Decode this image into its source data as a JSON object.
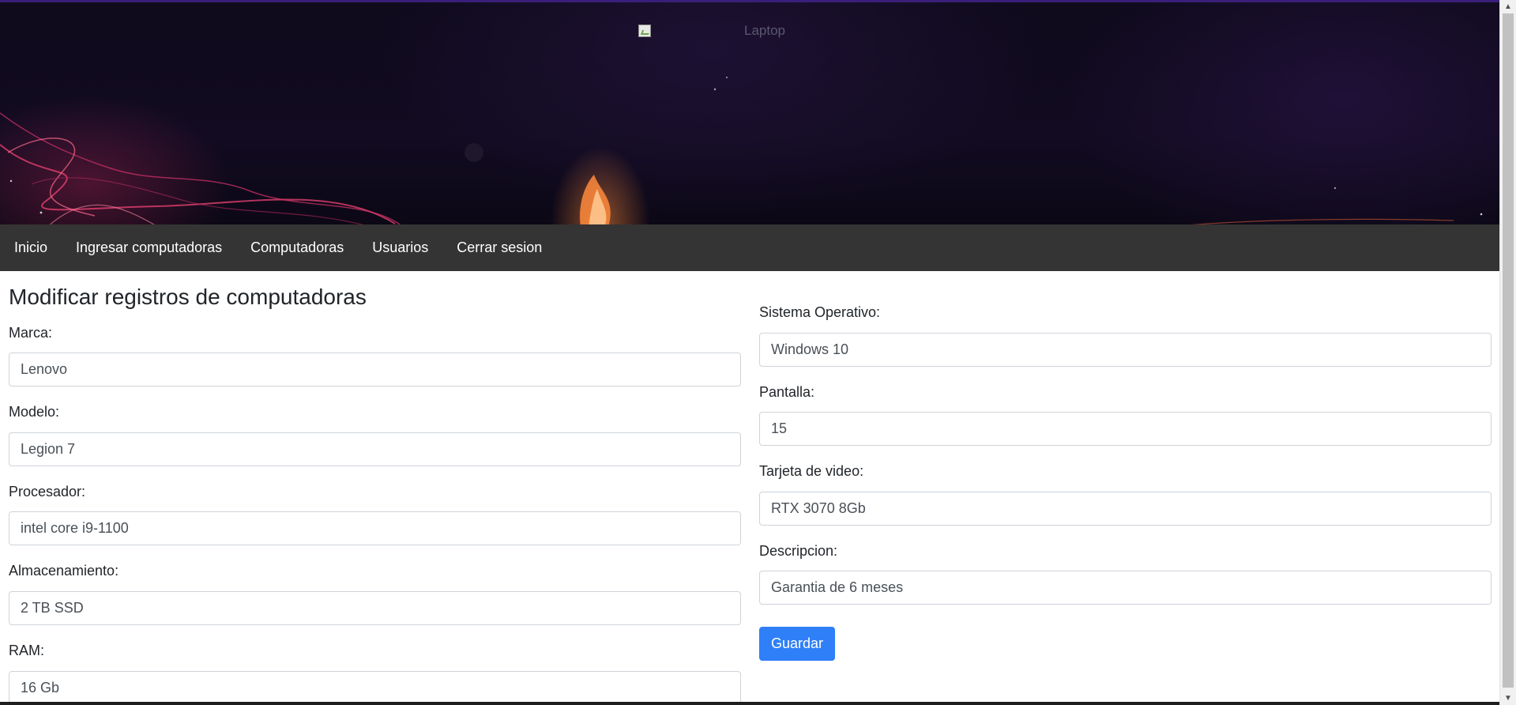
{
  "header": {
    "image_alt": "Laptop"
  },
  "nav": {
    "items": [
      {
        "label": "Inicio"
      },
      {
        "label": "Ingresar computadoras"
      },
      {
        "label": "Computadoras"
      },
      {
        "label": "Usuarios"
      },
      {
        "label": "Cerrar sesion"
      }
    ]
  },
  "form": {
    "title": "Modificar registros de computadoras",
    "left": [
      {
        "label": "Marca:",
        "value": "Lenovo"
      },
      {
        "label": "Modelo:",
        "value": "Legion 7"
      },
      {
        "label": "Procesador:",
        "value": "intel core i9-1100"
      },
      {
        "label": "Almacenamiento:",
        "value": "2 TB SSD"
      },
      {
        "label": "RAM:",
        "value": "16 Gb"
      }
    ],
    "right": [
      {
        "label": "Sistema Operativo:",
        "value": "Windows 10"
      },
      {
        "label": "Pantalla:",
        "value": "15"
      },
      {
        "label": "Tarjeta de video:",
        "value": "RTX 3070 8Gb"
      },
      {
        "label": "Descripcion:",
        "value": "Garantia de 6 meses"
      }
    ],
    "save_label": "Guardar"
  },
  "colors": {
    "navbar_bg": "#343434",
    "primary_button": "#2f7ff8",
    "banner_bg": "#120b21"
  }
}
